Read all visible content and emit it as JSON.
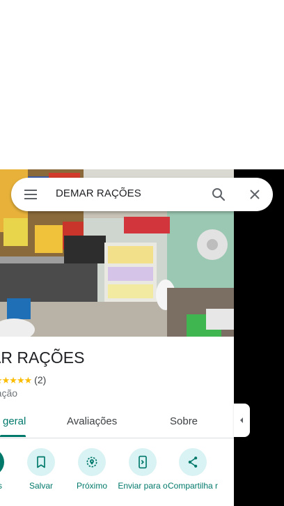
{
  "search": {
    "query": "DEMAR RAÇÕES"
  },
  "place": {
    "title": "AR RAÇÕES",
    "stars": "★★★★★",
    "review_count": "(2)",
    "category": "ração"
  },
  "tabs": [
    {
      "label": "geral",
      "active": true
    },
    {
      "label": "Avaliações",
      "active": false
    },
    {
      "label": "Sobre",
      "active": false
    }
  ],
  "actions": [
    {
      "label": "s",
      "icon": "directions-icon"
    },
    {
      "label": "Salvar",
      "icon": "bookmark-icon"
    },
    {
      "label": "Próximo",
      "icon": "nearby-icon"
    },
    {
      "label": "Enviar para o",
      "icon": "send-to-phone-icon"
    },
    {
      "label": "Compartilha r",
      "icon": "share-icon"
    }
  ],
  "colors": {
    "accent": "#00796b",
    "action_bg": "#d9f2f3",
    "star": "#fbbc04"
  }
}
